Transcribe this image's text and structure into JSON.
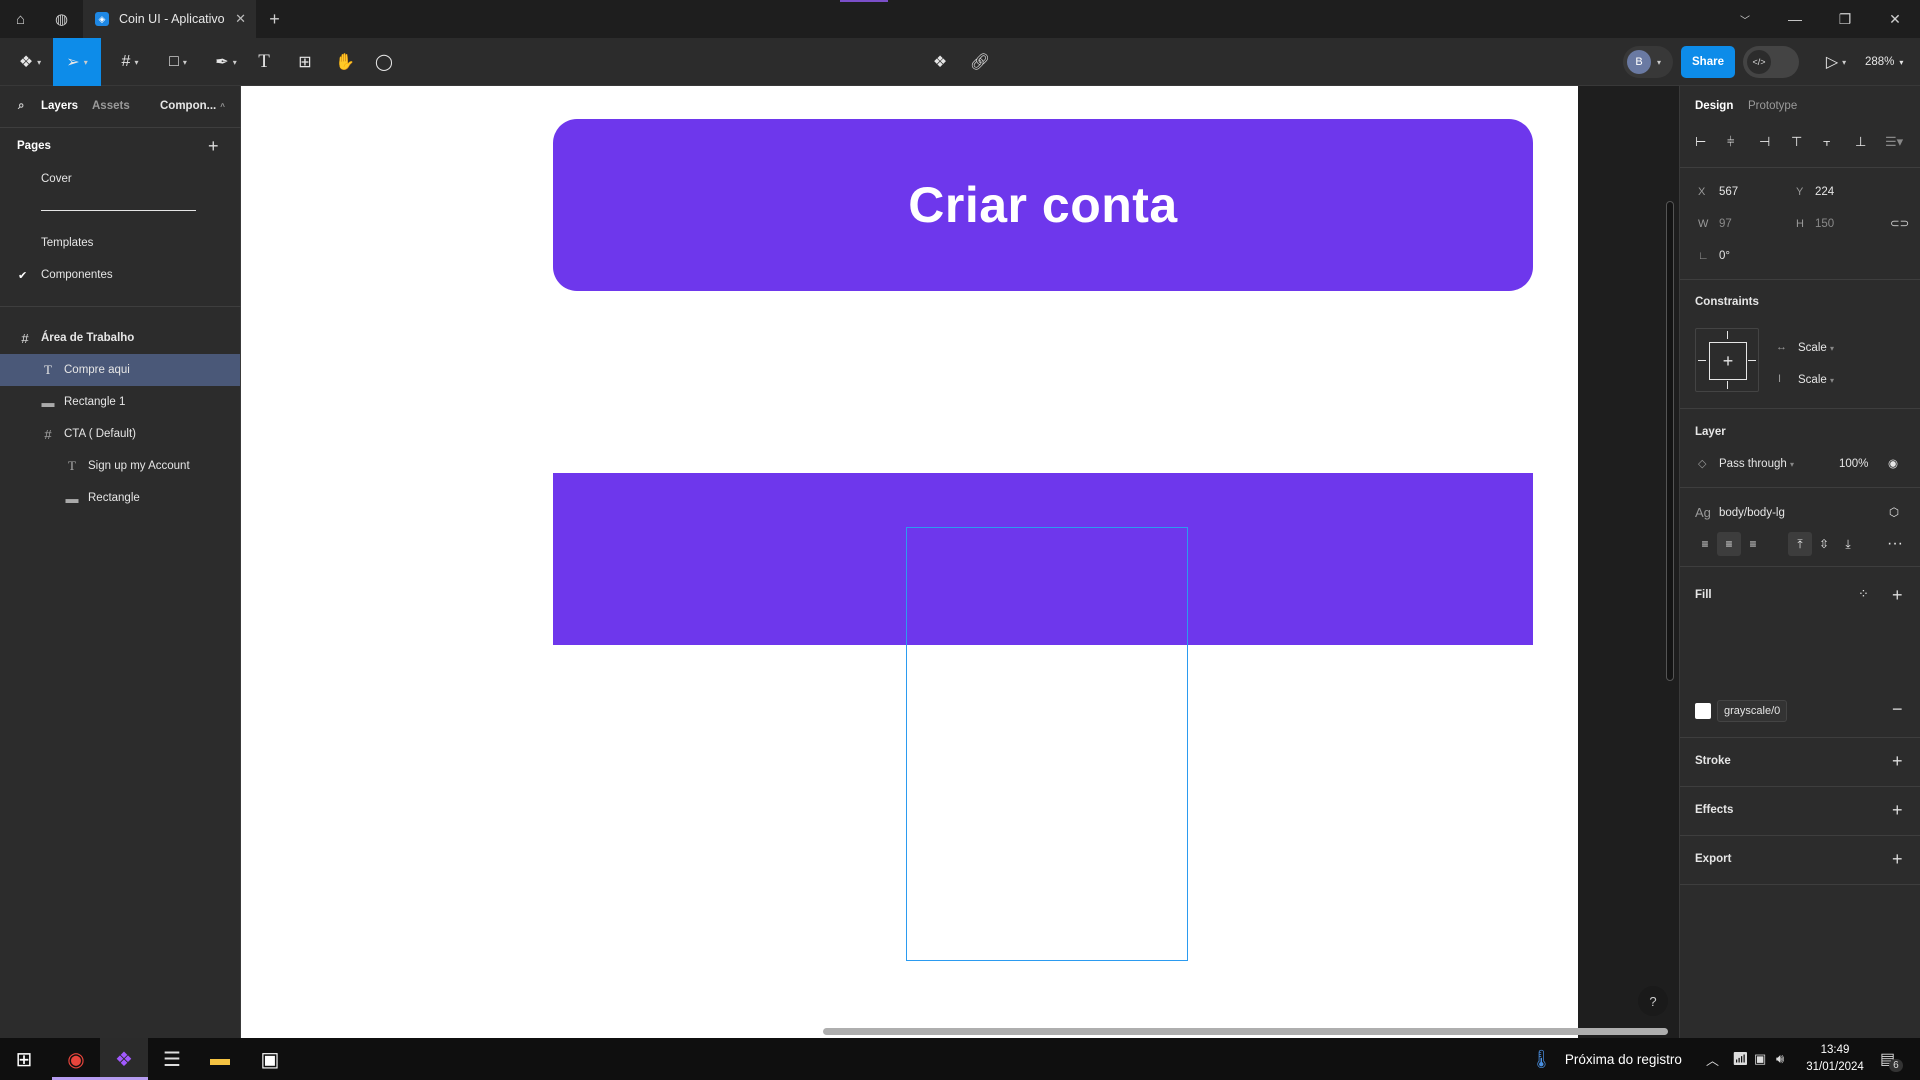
{
  "titlebar": {
    "tab_title": "Coin UI - Aplicativo",
    "new_tab": "+",
    "close_tab": "✕"
  },
  "toolbar": {
    "share_label": "Share",
    "avatar_initial": "B",
    "zoom_level": "288%",
    "devmode_icon": "</>"
  },
  "left_panel": {
    "tabs": [
      "Layers",
      "Assets"
    ],
    "page_dropdown": "Compon...",
    "pages_title": "Pages",
    "pages": [
      {
        "label": "Cover",
        "current": false
      },
      {
        "label": "____________________",
        "current": false
      },
      {
        "label": "Templates",
        "current": false
      },
      {
        "label": "Componentes",
        "current": true
      }
    ],
    "layers": [
      {
        "label": "Área de Trabalho",
        "icon": "frame-icon",
        "depth": 0,
        "selected": false
      },
      {
        "label": "Compre aqui",
        "icon": "text-icon",
        "depth": 1,
        "selected": true
      },
      {
        "label": "Rectangle 1",
        "icon": "rectangle-icon",
        "depth": 1,
        "selected": false
      },
      {
        "label": "CTA ( Default)",
        "icon": "frame-icon",
        "depth": 1,
        "selected": false
      },
      {
        "label": "Sign up my Account",
        "icon": "text-icon",
        "depth": 2,
        "selected": false
      },
      {
        "label": "Rectangle",
        "icon": "rectangle-icon",
        "depth": 2,
        "selected": false
      }
    ]
  },
  "canvas": {
    "cta_label": "Criar conta",
    "accent_color": "#6e37ec",
    "selection_color": "#2b9bf0"
  },
  "right_panel": {
    "tabs": [
      "Design",
      "Prototype"
    ],
    "position": {
      "x_label": "X",
      "x": "567",
      "y_label": "Y",
      "y": "224"
    },
    "size": {
      "w_label": "W",
      "w": "97",
      "h_label": "H",
      "h": "150"
    },
    "rotation": "0°",
    "constraints_title": "Constraints",
    "constraint_h": "Scale",
    "constraint_v": "Scale",
    "layer_title": "Layer",
    "blend_mode": "Pass through",
    "opacity": "100%",
    "text_style_icon": "Ag",
    "text_style": "body/body-lg",
    "fill_title": "Fill",
    "fill_name": "grayscale/0",
    "fill_color": "#ffffff",
    "stroke_title": "Stroke",
    "effects_title": "Effects",
    "export_title": "Export"
  },
  "taskbar": {
    "weather_text": "Próxima do registro",
    "time": "13:49",
    "date": "31/01/2024",
    "notification_count": "6"
  },
  "help_label": "?"
}
